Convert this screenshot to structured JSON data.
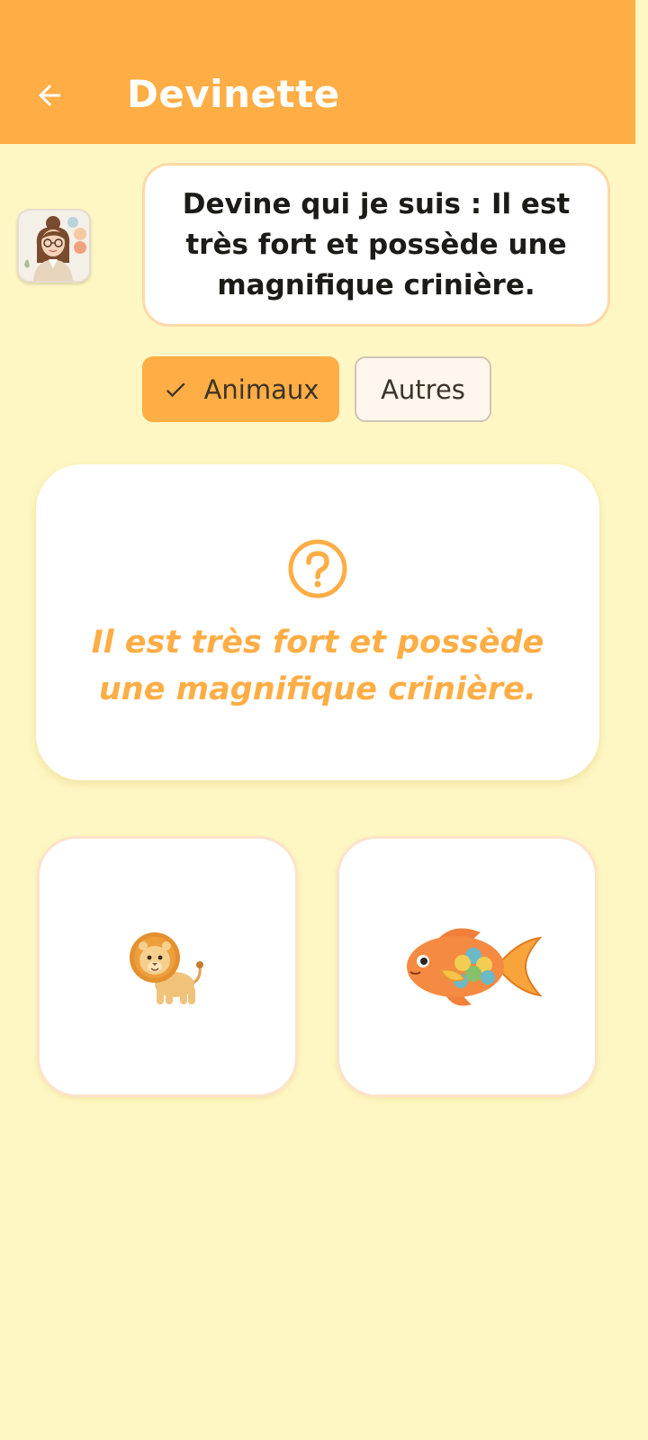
{
  "header": {
    "title": "Devinette",
    "back_icon": "arrow-left-icon"
  },
  "speaker": {
    "avatar_icon": "teacher-avatar",
    "bubble_text": "Devine qui je suis : Il est très fort et possède une magnifique crinière."
  },
  "categories": [
    {
      "label": "Animaux",
      "selected": true,
      "icon": "check-icon"
    },
    {
      "label": "Autres",
      "selected": false
    }
  ],
  "riddle": {
    "icon": "question-circle-icon",
    "text": "Il est très fort et possède une magnifique crinière."
  },
  "answers": [
    {
      "icon": "lion-icon"
    },
    {
      "icon": "fish-icon"
    }
  ],
  "colors": {
    "accent": "#FFAD45",
    "background": "#FEF7C3",
    "card": "#FFFFFF",
    "bubble_border": "#FDD9A6"
  }
}
